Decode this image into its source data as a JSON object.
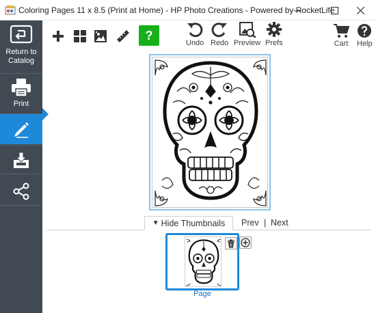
{
  "window": {
    "title": "Coloring Pages 11 x 8.5 (Print at Home) - HP Photo Creations - Powered by RocketLife",
    "controls": [
      "minimize",
      "maximize",
      "close"
    ]
  },
  "sidebar": {
    "items": [
      {
        "label_line1": "Return to",
        "label_line2": "Catalog",
        "icon": "return-icon"
      },
      {
        "label": "Print",
        "icon": "printer-icon"
      },
      {
        "label": "",
        "icon": "pencil-icon",
        "active": true
      },
      {
        "label": "",
        "icon": "save-download-icon"
      },
      {
        "label": "",
        "icon": "share-icon"
      }
    ]
  },
  "toolbar": {
    "tools": [
      {
        "icon": "add-icon",
        "label": ""
      },
      {
        "icon": "layout-icon",
        "label": ""
      },
      {
        "icon": "photo-icon",
        "label": ""
      },
      {
        "icon": "ruler-icon",
        "label": ""
      },
      {
        "icon": "help-question-icon",
        "label": "?"
      }
    ],
    "undo_label": "Undo",
    "redo_label": "Redo",
    "preview_label": "Preview",
    "prefs_label": "Prefs",
    "cart_label": "Cart",
    "help_label": "Help"
  },
  "thumbnails": {
    "toggle_arrow": "▼",
    "toggle_label": "Hide Thumbnails",
    "prev_label": "Prev",
    "separator": "|",
    "next_label": "Next",
    "pages": [
      {
        "label": "Page",
        "selected": true
      }
    ]
  },
  "colors": {
    "sidebar_bg": "#414a52",
    "accent_blue": "#1e88d9",
    "help_green": "#18b01a"
  }
}
